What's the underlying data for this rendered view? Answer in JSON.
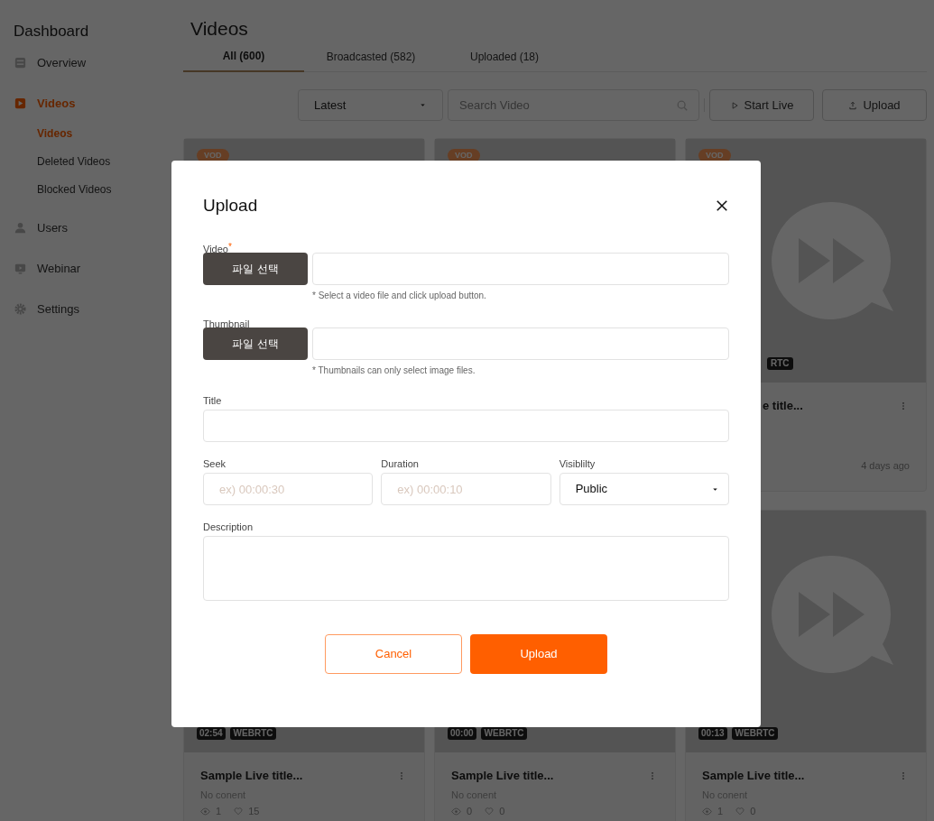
{
  "sidebar": {
    "title": "Dashboard",
    "items": [
      {
        "label": "Overview",
        "selected": false
      },
      {
        "label": "Videos",
        "selected": true,
        "children": [
          {
            "label": "Videos",
            "selected": true
          },
          {
            "label": "Deleted Videos",
            "selected": false
          },
          {
            "label": "Blocked Videos",
            "selected": false
          }
        ]
      },
      {
        "label": "Users",
        "selected": false
      },
      {
        "label": "Webinar",
        "selected": false
      },
      {
        "label": "Settings",
        "selected": false
      }
    ]
  },
  "page": {
    "title": "Videos",
    "tabs": [
      {
        "label": "All (600)",
        "selected": true
      },
      {
        "label": "Broadcasted (582)",
        "selected": false
      },
      {
        "label": "Uploaded (18)",
        "selected": false
      }
    ],
    "sort": {
      "value": "Latest"
    },
    "search": {
      "placeholder": "Search Video"
    },
    "buttons": [
      {
        "label": "Start Live"
      },
      {
        "label": "Upload"
      }
    ]
  },
  "cards": [
    {
      "top_badge": "VOD"
    },
    {
      "top_badge": "VOD"
    },
    {
      "clipped": true,
      "top_badge": "VOD",
      "logo": true,
      "source": "RTC",
      "title": "e title...",
      "date": "4 days ago"
    },
    {
      "clipped": false,
      "duration": "02:54",
      "source": "WEBRTC",
      "title": "Sample Live title...",
      "description": "No conent",
      "views": "1",
      "likes": "15"
    },
    {
      "clipped": false,
      "duration": "00:00",
      "source": "WEBRTC",
      "title": "Sample Live title...",
      "description": "No conent",
      "views": "0",
      "likes": "0"
    },
    {
      "clipped": false,
      "logo": true,
      "duration": "00:13",
      "source": "WEBRTC",
      "title": "Sample Live title...",
      "description": "No conent",
      "views": "1",
      "likes": "0"
    }
  ],
  "modal": {
    "title": "Upload",
    "file_fields": [
      {
        "label": "Video",
        "required_mark": "*",
        "button": "파일 선택",
        "hint": "* Select a video file and click upload button."
      },
      {
        "label": "Thumbnail",
        "button": "파일 선택",
        "hint": "* Thumbnails can only select image files."
      }
    ],
    "title_field": {
      "label": "Title"
    },
    "seek": {
      "label": "Seek",
      "placeholder": "ex) 00:00:30"
    },
    "duration": {
      "label": "Duration",
      "placeholder": "ex) 00:00:10"
    },
    "visibility": {
      "label": "Visiblilty",
      "value": "Public"
    },
    "description": {
      "label": "Description"
    },
    "cancel": "Cancel",
    "submit": "Upload"
  }
}
